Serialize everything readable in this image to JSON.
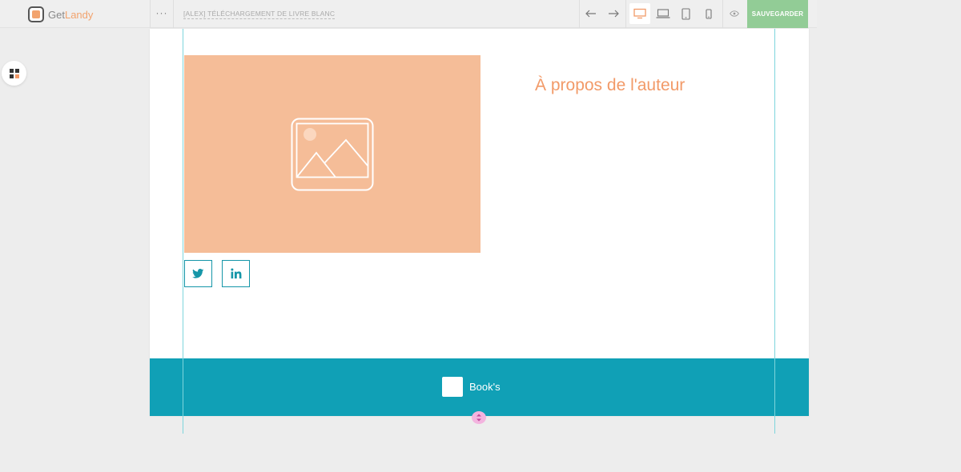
{
  "header": {
    "logo_prefix": "Get",
    "logo_suffix": "Landy",
    "more_label": "···",
    "page_title": "[ALEX] TÉLÉCHARGEMENT DE LIVRE BLANC",
    "save_label": "SAUVEGARDER"
  },
  "toolbar": {
    "undo_icon": "arrow-left-icon",
    "redo_icon": "arrow-right-icon",
    "devices": [
      "desktop",
      "laptop",
      "tablet",
      "mobile"
    ],
    "active_device": "desktop",
    "preview_icon": "eye-icon"
  },
  "content": {
    "author_title": "À propos de l'auteur",
    "image_placeholder_icon": "image-icon",
    "social": [
      "twitter",
      "linkedin"
    ]
  },
  "footer": {
    "brand": "Book's"
  },
  "colors": {
    "accent": "#f29a68",
    "image_bg": "#f5bd98",
    "footer_bg": "#10a0b6",
    "save_bg": "#92cc96",
    "guide": "#7ed5dc"
  }
}
